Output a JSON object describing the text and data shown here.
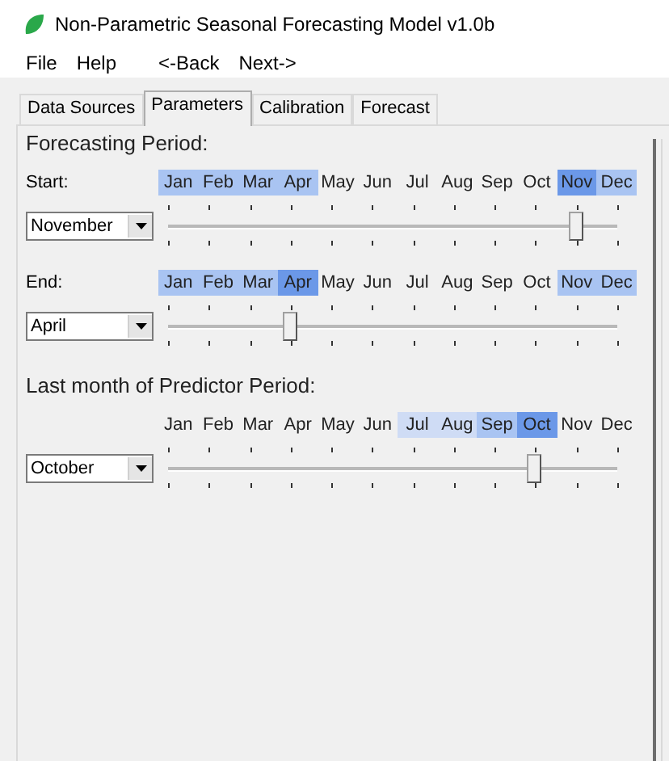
{
  "window": {
    "title": "Non-Parametric Seasonal Forecasting Model v1.0b"
  },
  "menu": [
    {
      "label": "File"
    },
    {
      "label": "Help"
    },
    {
      "label": "<-Back"
    },
    {
      "label": "Next->"
    }
  ],
  "tabs": [
    {
      "label": "Data Sources",
      "selected": false
    },
    {
      "label": "Parameters",
      "selected": true
    },
    {
      "label": "Calibration",
      "selected": false
    },
    {
      "label": "Forecast",
      "selected": false
    }
  ],
  "sections": [
    {
      "heading": "Forecasting Period:",
      "pickers": [
        {
          "label": "Start:",
          "value": "November",
          "level": 0.909,
          "months": [
            {
              "name": "Jan",
              "color": "#a9c4f2"
            },
            {
              "name": "Feb",
              "color": "#a9c4f2"
            },
            {
              "name": "Mar",
              "color": "#a9c4f2"
            },
            {
              "name": "Apr",
              "color": "#a9c4f2"
            },
            {
              "name": "May"
            },
            {
              "name": "Jun"
            },
            {
              "name": "Jul"
            },
            {
              "name": "Aug"
            },
            {
              "name": "Sep"
            },
            {
              "name": "Oct"
            },
            {
              "name": "Nov",
              "color": "#6b98e8"
            },
            {
              "name": "Dec",
              "color": "#a9c4f2"
            }
          ]
        },
        {
          "label": "End:",
          "value": "April",
          "level": 0.273,
          "months": [
            {
              "name": "Jan",
              "color": "#a9c4f2"
            },
            {
              "name": "Feb",
              "color": "#a9c4f2"
            },
            {
              "name": "Mar",
              "color": "#a9c4f2"
            },
            {
              "name": "Apr",
              "color": "#6b98e8"
            },
            {
              "name": "May"
            },
            {
              "name": "Jun"
            },
            {
              "name": "Jul"
            },
            {
              "name": "Aug"
            },
            {
              "name": "Sep"
            },
            {
              "name": "Oct"
            },
            {
              "name": "Nov",
              "color": "#a9c4f2"
            },
            {
              "name": "Dec",
              "color": "#a9c4f2"
            }
          ]
        }
      ]
    },
    {
      "heading": "Last month of Predictor Period:",
      "pickers": [
        {
          "value": "October",
          "level": 0.818,
          "months": [
            {
              "name": "Jan"
            },
            {
              "name": "Feb"
            },
            {
              "name": "Mar"
            },
            {
              "name": "Apr"
            },
            {
              "name": "May"
            },
            {
              "name": "Jun"
            },
            {
              "name": "Jul",
              "color": "#cfdcf5"
            },
            {
              "name": "Aug",
              "color": "#cfdcf5"
            },
            {
              "name": "Sep",
              "color": "#a9c4f2"
            },
            {
              "name": "Oct",
              "color": "#6b98e8"
            },
            {
              "name": "Nov"
            },
            {
              "name": "Dec"
            }
          ]
        }
      ]
    }
  ]
}
